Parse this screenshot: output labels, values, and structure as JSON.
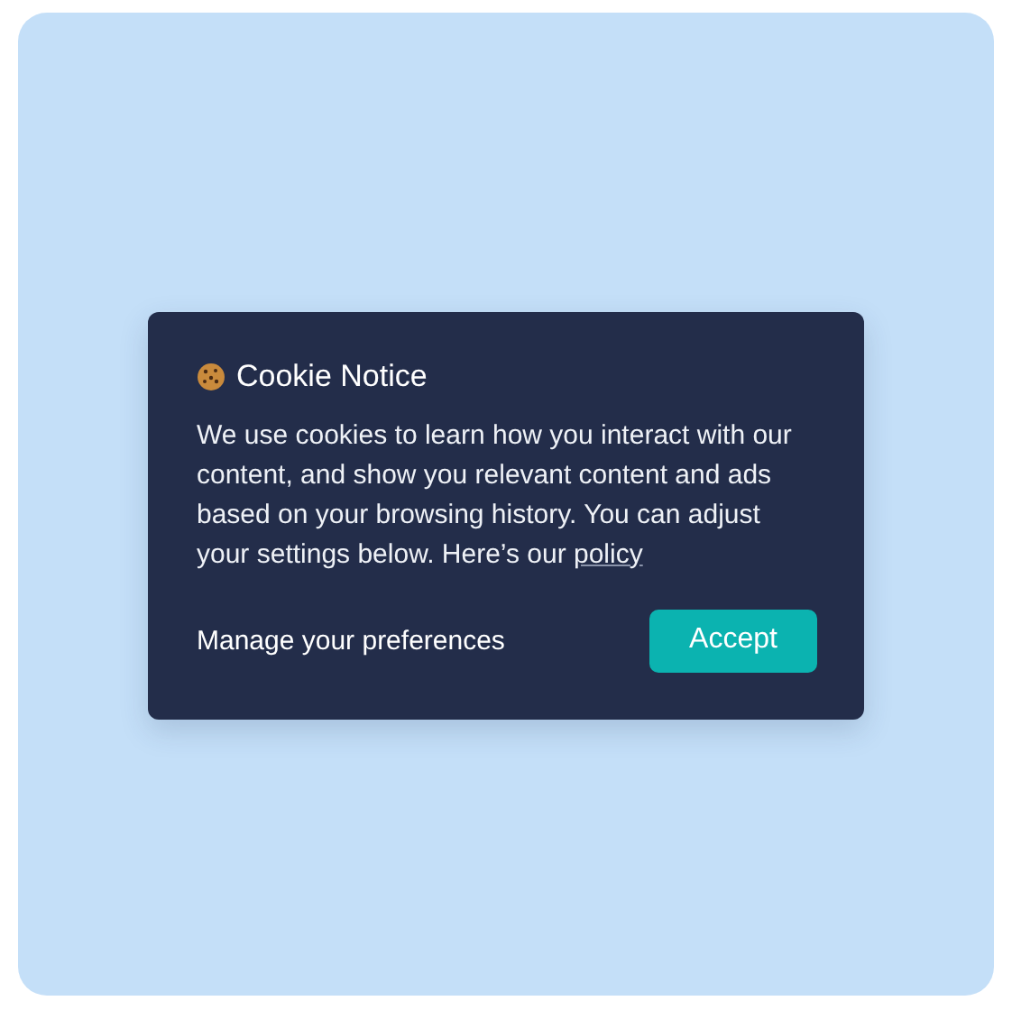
{
  "notice": {
    "title": "Cookie Notice",
    "message": "We use cookies to learn how you interact with our content, and show you relevant content and ads based on your browsing history. You can adjust your settings below. Here’s our",
    "link": "policy",
    "manage": "Manage your preferences",
    "accept": "Accept"
  }
}
